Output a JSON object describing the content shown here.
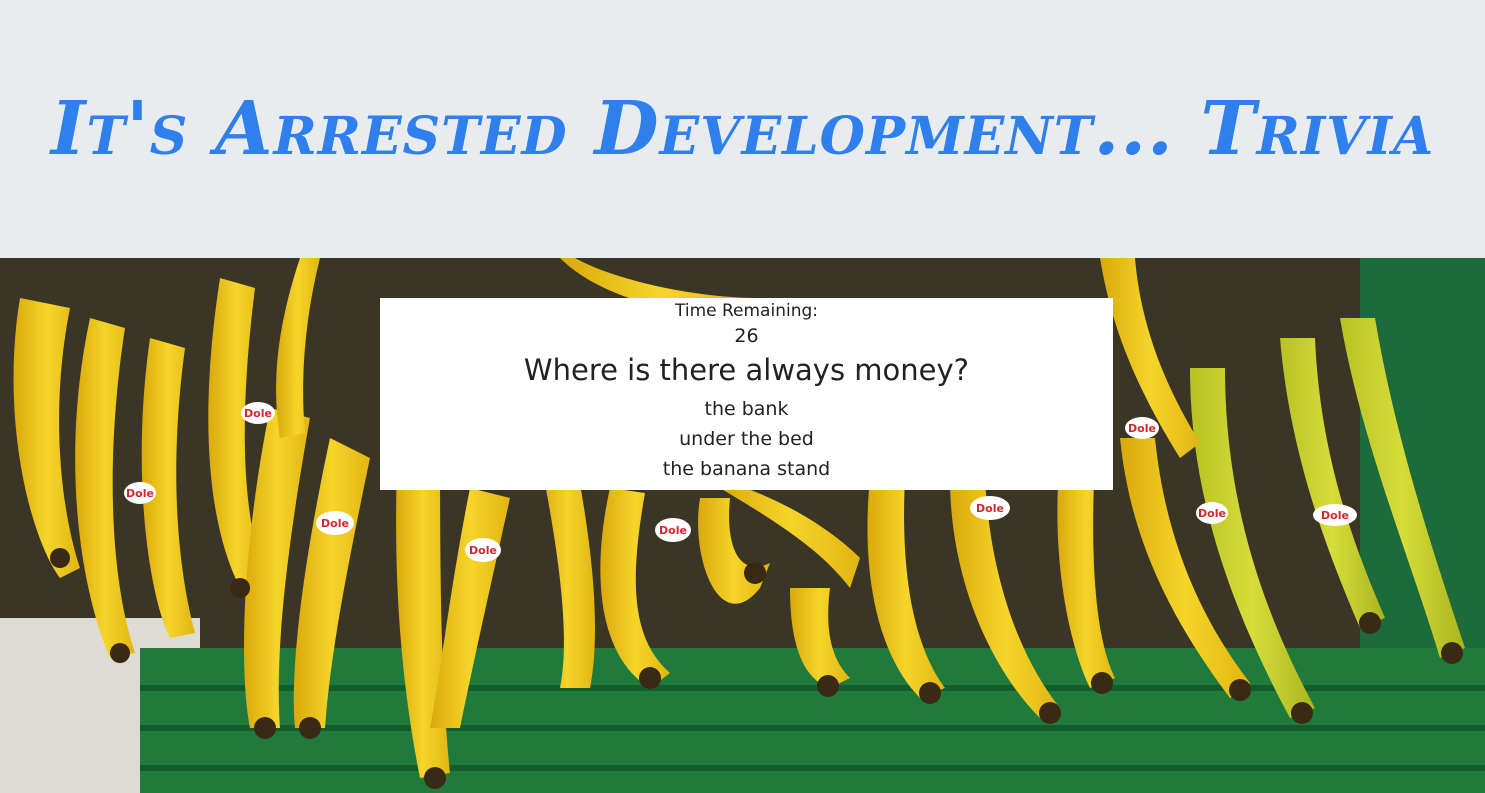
{
  "header": {
    "title": "It's Arrested Development... Trivia"
  },
  "quiz": {
    "timer_label": "Time Remaining:",
    "timer_value": "26",
    "question": "Where is there always money?",
    "answers": [
      "the bank",
      "under the bed",
      "the banana stand"
    ]
  },
  "colors": {
    "title": "#2f80ed",
    "header_bg": "#e9ecef",
    "card_bg": "#ffffff",
    "banana": "#f2c919",
    "crate": "#1f7a3c"
  },
  "background_image": {
    "stickers": [
      "Dole",
      "Dole",
      "Dole",
      "Dole",
      "Dole",
      "Dole",
      "Dole",
      "Dole",
      "Dole"
    ]
  }
}
